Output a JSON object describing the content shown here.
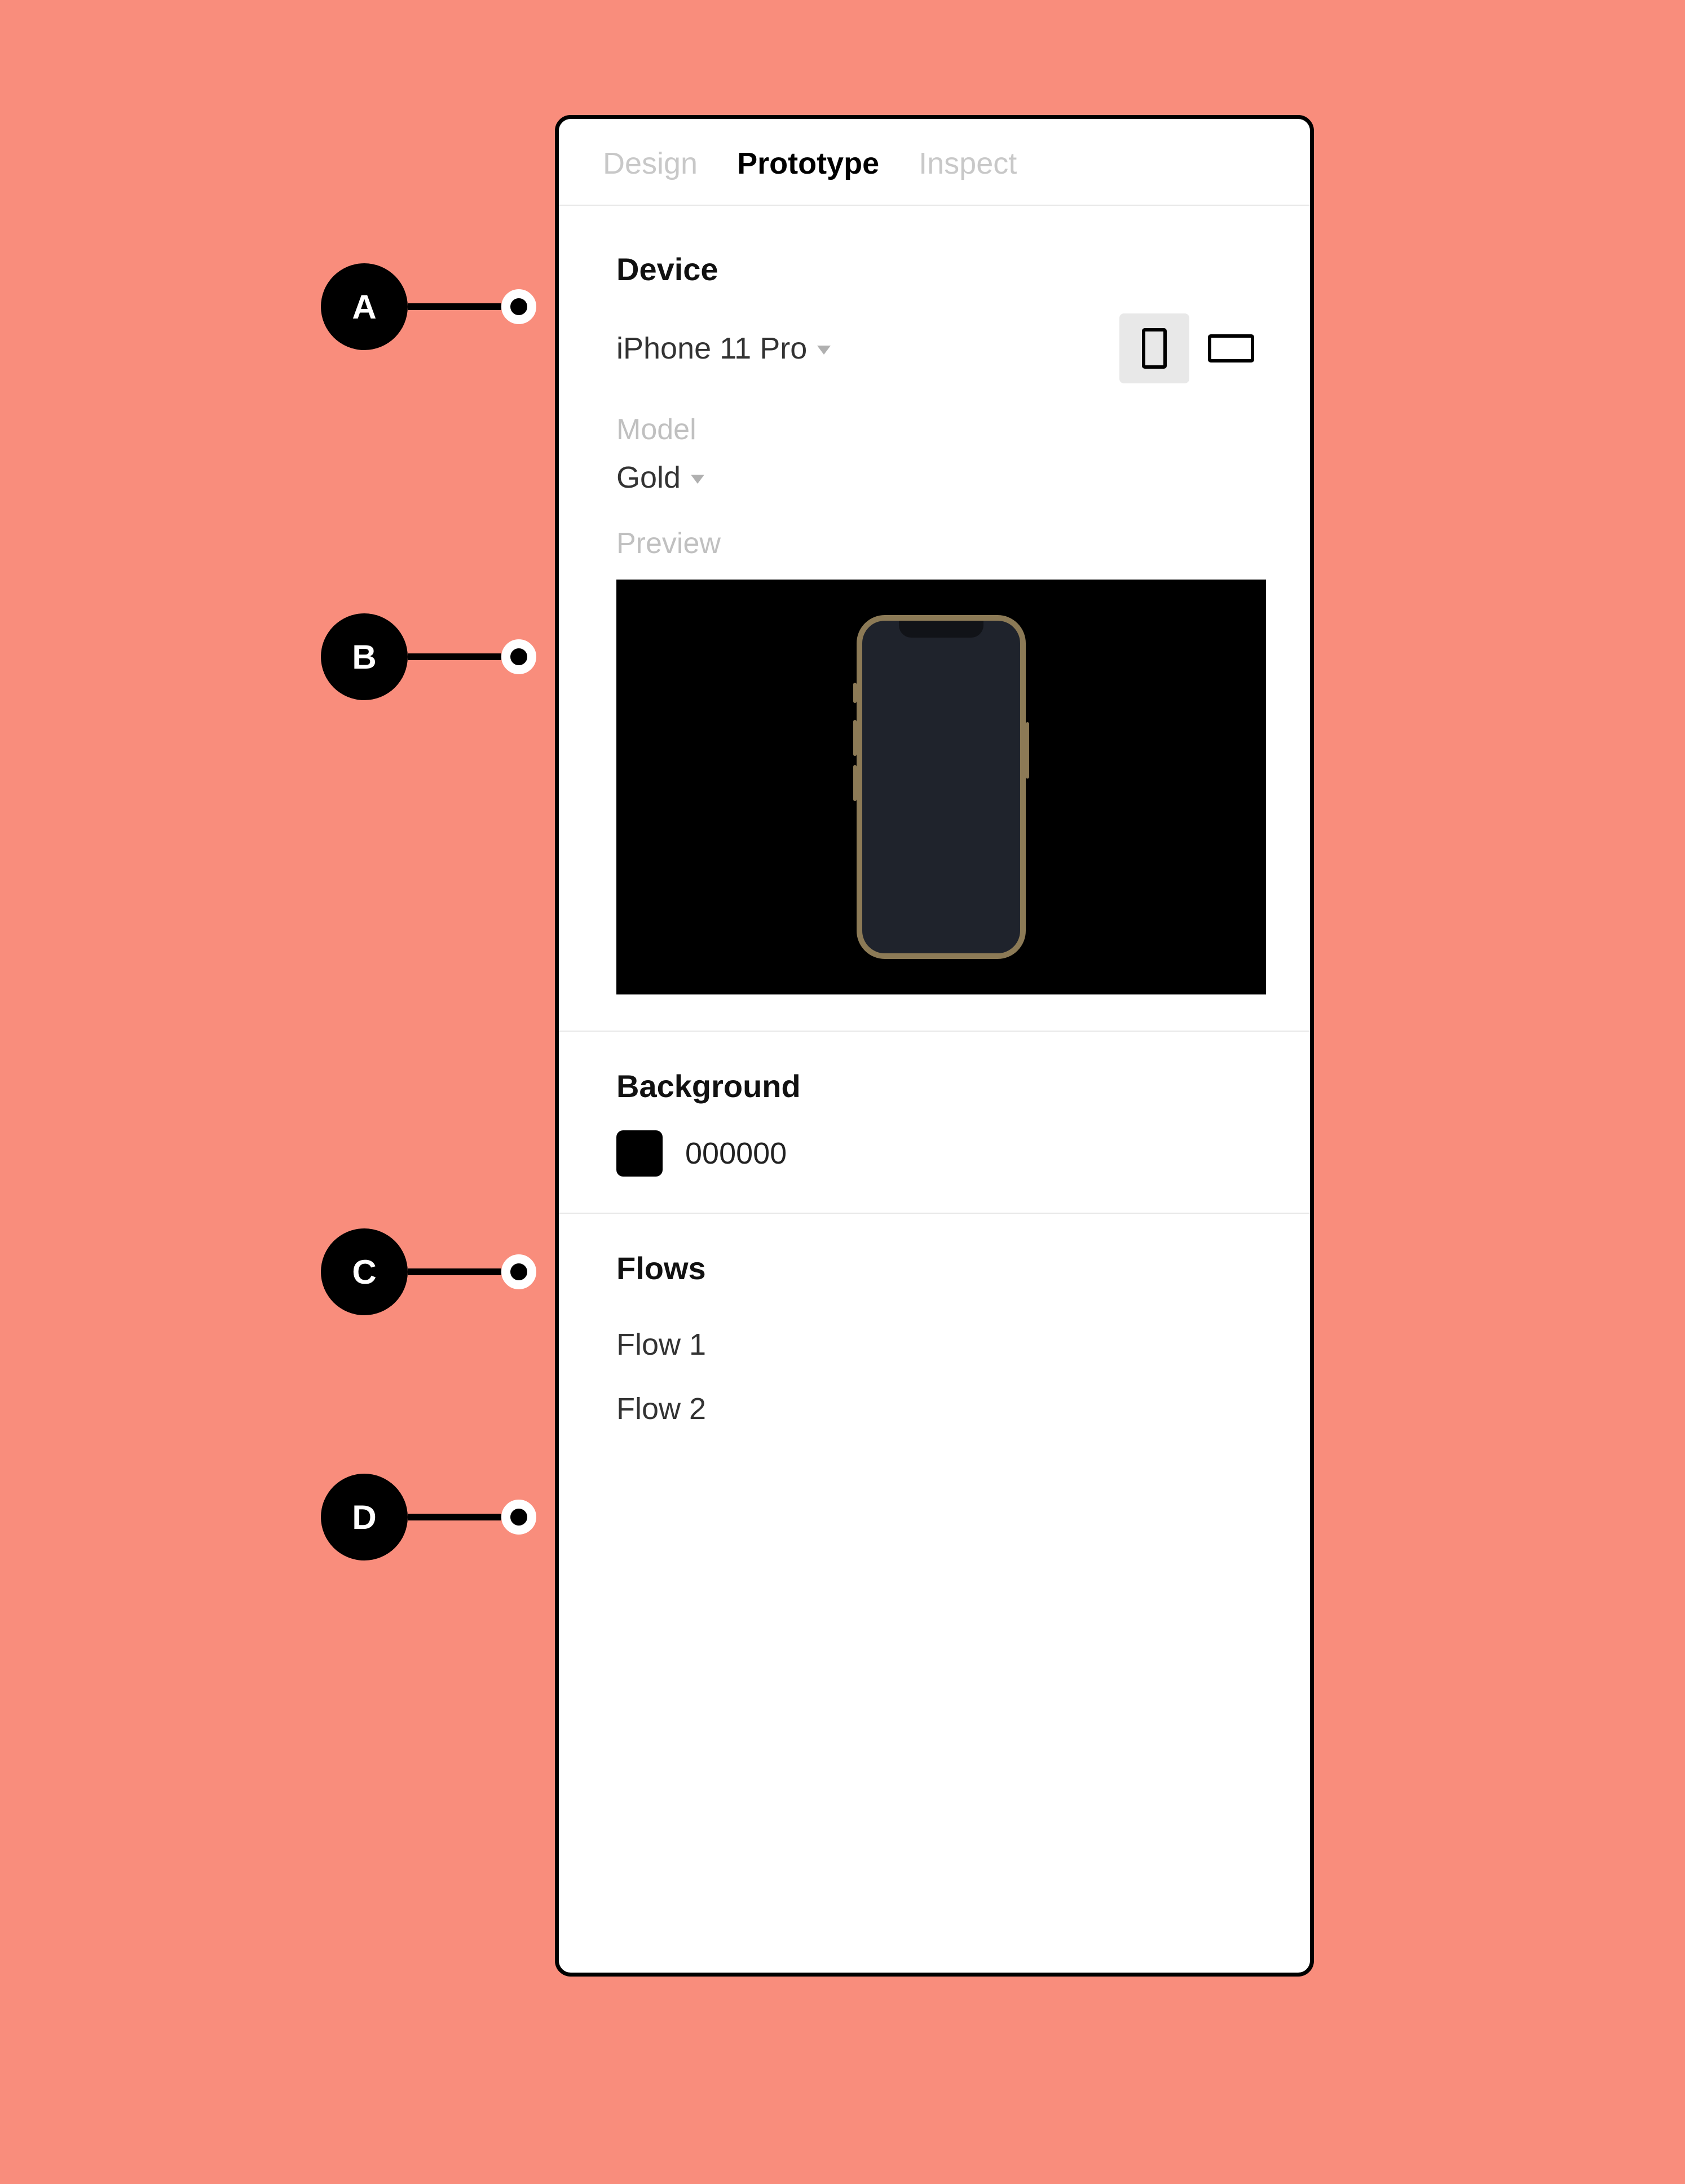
{
  "tabs": {
    "design": "Design",
    "prototype": "Prototype",
    "inspect": "Inspect"
  },
  "device": {
    "title": "Device",
    "selected": "iPhone 11 Pro",
    "model_label": "Model",
    "model_value": "Gold",
    "preview_label": "Preview"
  },
  "background": {
    "title": "Background",
    "hex": "000000",
    "swatch_color": "#000000"
  },
  "flows": {
    "title": "Flows",
    "items": [
      "Flow 1",
      "Flow 2"
    ]
  },
  "callouts": {
    "a": "A",
    "b": "B",
    "c": "C",
    "d": "D"
  }
}
